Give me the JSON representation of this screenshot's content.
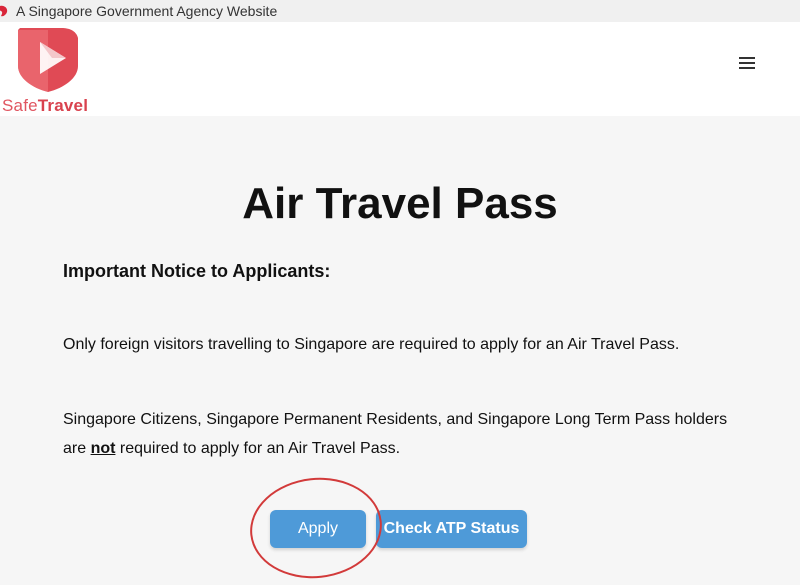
{
  "gov_banner": {
    "text": "A Singapore Government Agency Website",
    "icon": "lion-head-icon"
  },
  "header": {
    "logo_safe": "Safe",
    "logo_travel": "Travel",
    "menu_icon": "hamburger-menu-icon"
  },
  "main": {
    "title": "Air Travel Pass",
    "notice_heading": "Important Notice to Applicants:",
    "para1": "Only foreign visitors travelling to Singapore are required to apply for an Air Travel Pass.",
    "para2_line1": "Singapore Citizens, Singapore Permanent Residents, and Singapore Long Term Pass holders",
    "para2_pre": "are ",
    "para2_emph": "not",
    "para2_post": " required to apply for an Air Travel Pass."
  },
  "buttons": {
    "apply_label": "Apply",
    "check_label": "Check ATP Status"
  },
  "colors": {
    "brand_red": "#d9424e",
    "button_blue": "#4e9ad8",
    "annotation_red": "#d23a3a"
  }
}
